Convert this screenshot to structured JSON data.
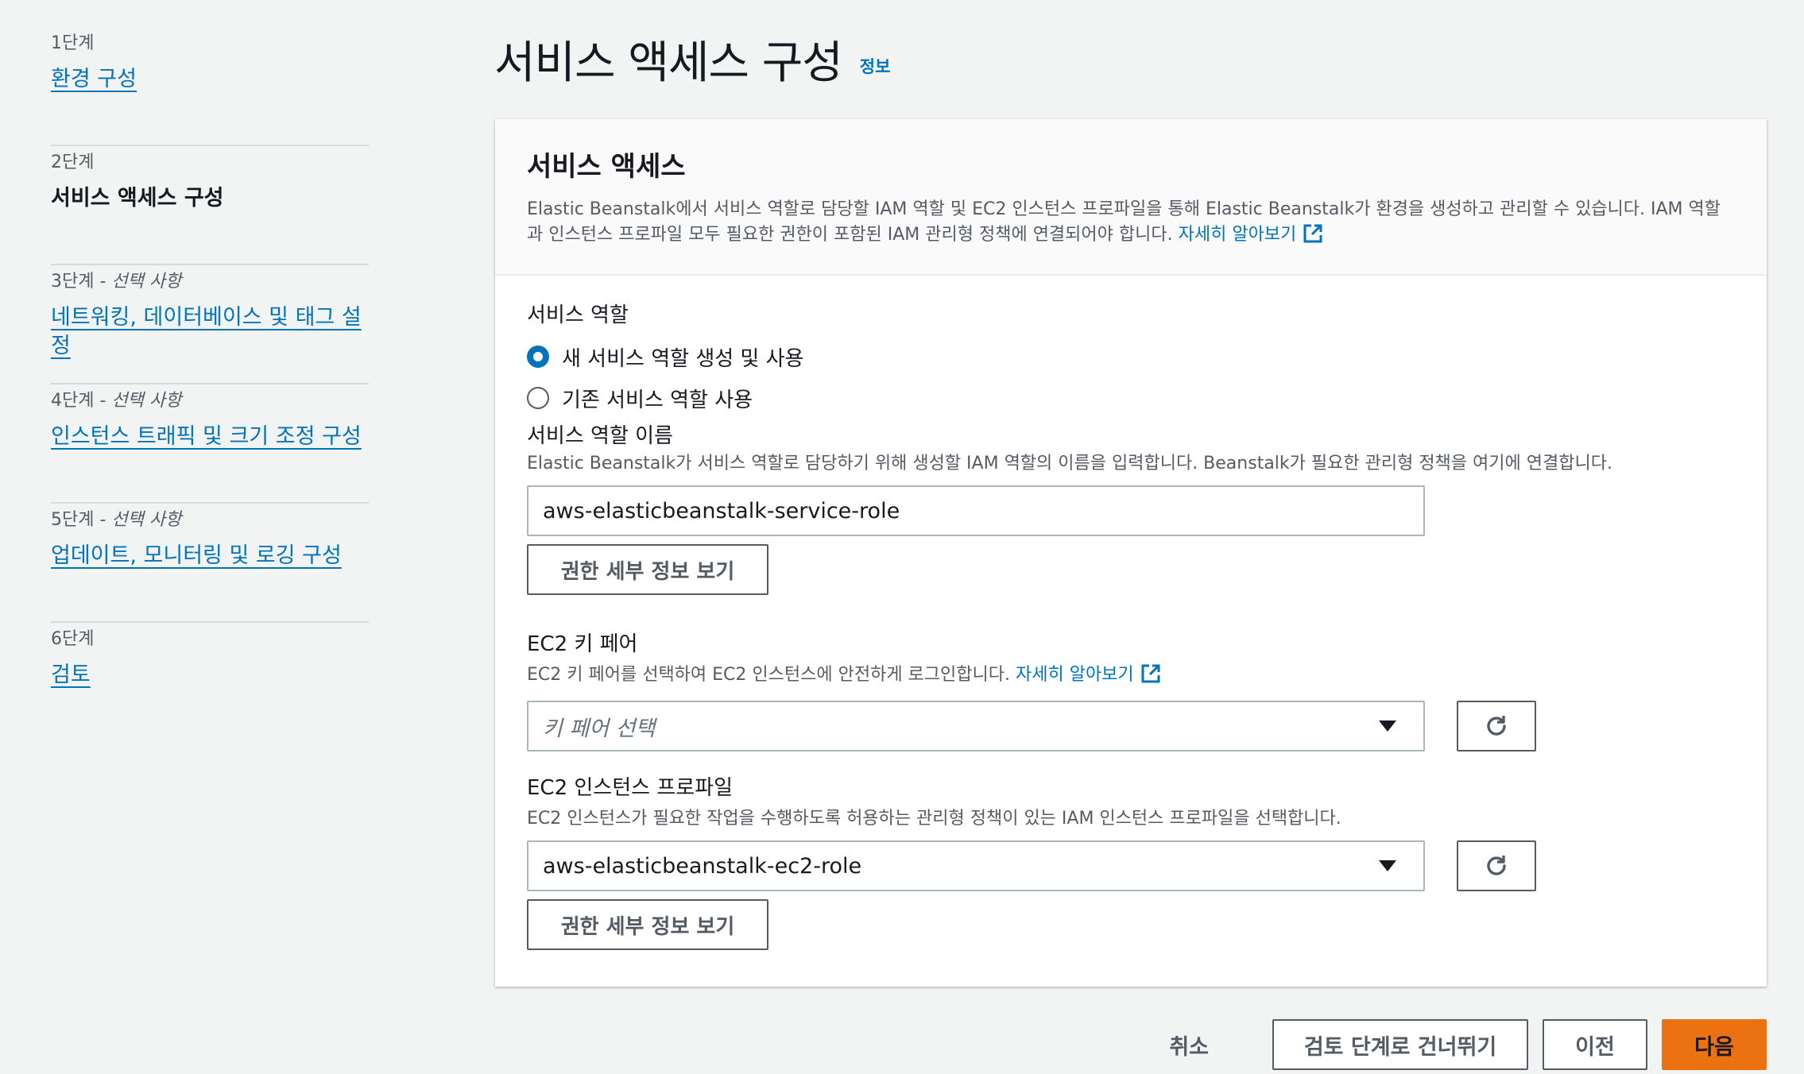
{
  "steps": [
    {
      "num": "1단계",
      "label": "환경 구성",
      "optional": "",
      "state": "link"
    },
    {
      "num": "2단계",
      "label": "서비스 액세스 구성",
      "optional": "",
      "state": "active"
    },
    {
      "num": "3단계",
      "label": "네트워킹, 데이터베이스 및 태그 설정",
      "optional": "선택 사항",
      "state": "link"
    },
    {
      "num": "4단계",
      "label": "인스턴스 트래픽 및 크기 조정 구성",
      "optional": "선택 사항",
      "state": "link"
    },
    {
      "num": "5단계",
      "label": "업데이트, 모니터링 및 로깅 구성",
      "optional": "선택 사항",
      "state": "link"
    },
    {
      "num": "6단계",
      "label": "검토",
      "optional": "",
      "state": "link"
    }
  ],
  "optional_sep": " - ",
  "page": {
    "title": "서비스 액세스 구성",
    "info": "정보"
  },
  "panel": {
    "title": "서비스 액세스",
    "description": "Elastic Beanstalk에서 서비스 역할로 담당할 IAM 역할 및 EC2 인스턴스 프로파일을 통해 Elastic Beanstalk가 환경을 생성하고 관리할 수 있습니다. IAM 역할과 인스턴스 프로파일 모두 필요한 권한이 포함된 IAM 관리형 정책에 연결되어야 합니다.",
    "learn_more": "자세히 알아보기"
  },
  "service_role": {
    "label": "서비스 역할",
    "options": [
      "새 서비스 역할 생성 및 사용",
      "기존 서비스 역할 사용"
    ],
    "selected_index": 0,
    "name_label": "서비스 역할 이름",
    "name_desc": "Elastic Beanstalk가 서비스 역할로 담당하기 위해 생성할 IAM 역할의 이름을 입력합니다. Beanstalk가 필요한 관리형 정책을 여기에 연결합니다.",
    "name_value": "aws-elasticbeanstalk-service-role",
    "view_permissions": "권한 세부 정보 보기"
  },
  "key_pair": {
    "label": "EC2 키 페어",
    "desc": "EC2 키 페어를 선택하여 EC2 인스턴스에 안전하게 로그인합니다.",
    "learn_more": "자세히 알아보기",
    "placeholder": "키 페어 선택"
  },
  "instance_profile": {
    "label": "EC2 인스턴스 프로파일",
    "desc": "EC2 인스턴스가 필요한 작업을 수행하도록 허용하는 관리형 정책이 있는 IAM 인스턴스 프로파일을 선택합니다.",
    "value": "aws-elasticbeanstalk-ec2-role",
    "view_permissions": "권한 세부 정보 보기"
  },
  "footer": {
    "cancel": "취소",
    "skip": "검토 단계로 건너뛰기",
    "previous": "이전",
    "next": "다음"
  },
  "colors": {
    "link": "#0073bb",
    "primary": "#ec7211",
    "background": "#f2f3f3"
  },
  "icons": [
    "external-link-icon",
    "refresh-icon",
    "caret-down-icon"
  ]
}
